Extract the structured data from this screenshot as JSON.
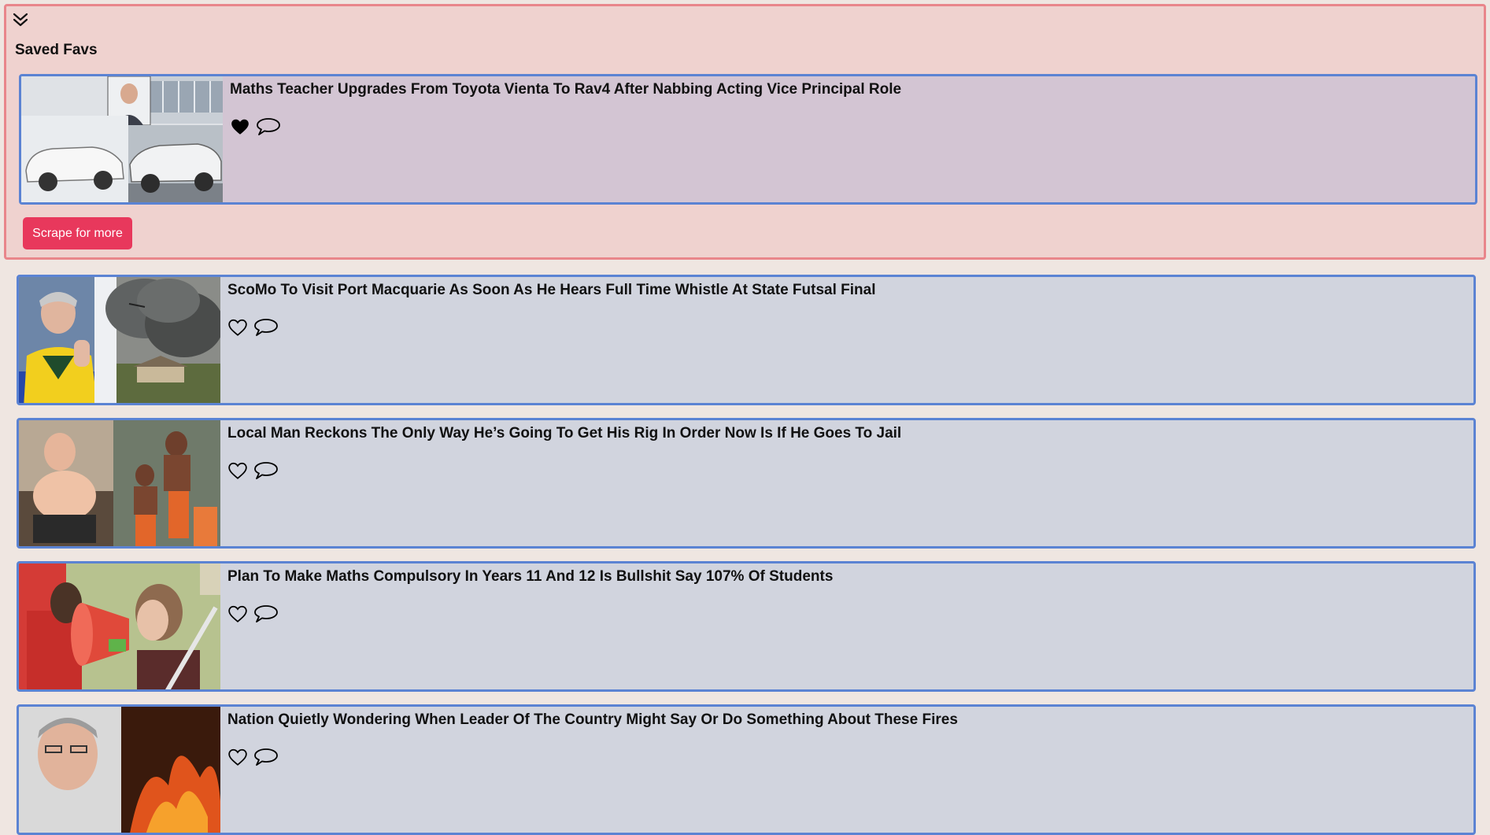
{
  "favs": {
    "title": "Saved Favs",
    "scrape_label": "Scrape for more",
    "items": [
      {
        "headline": "Maths Teacher Upgrades From Toyota Vienta To Rav4 After Nabbing Acting Vice Principal Role",
        "liked": true
      }
    ]
  },
  "feed": {
    "items": [
      {
        "headline": "ScoMo To Visit Port Macquarie As Soon As He Hears Full Time Whistle At State Futsal Final",
        "liked": false
      },
      {
        "headline": "Local Man Reckons The Only Way He’s Going To Get His Rig In Order Now Is If He Goes To Jail",
        "liked": false
      },
      {
        "headline": "Plan To Make Maths Compulsory In Years 11 And 12 Is Bullshit Say 107% Of Students",
        "liked": false
      },
      {
        "headline": "Nation Quietly Wondering When Leader Of The Country Might Say Or Do Something About These Fires",
        "liked": false
      }
    ]
  },
  "icons": {
    "collapse": "double-chevron-down-icon",
    "like_filled": "heart-filled-icon",
    "like_outline": "heart-outline-icon",
    "comment": "speech-bubble-icon"
  },
  "colors": {
    "page_bg": "#efe6e1",
    "favs_bg": "#efd2cf",
    "favs_border": "#e9868b",
    "card_border": "#5b83d3",
    "card_bg": "#d1d4de",
    "fav_card_bg": "#d3c5d3",
    "button_bg": "#e8385c"
  }
}
